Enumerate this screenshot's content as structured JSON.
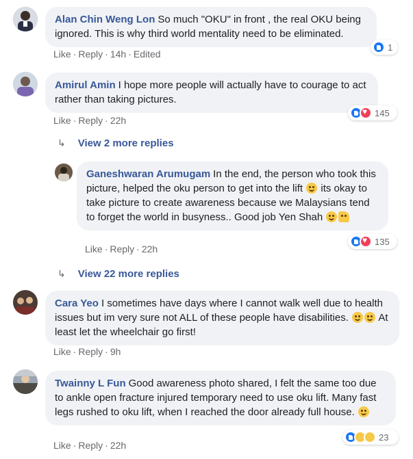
{
  "comments": [
    {
      "author": "Alan Chin Weng Lon",
      "text": "So much \"OKU\" in front , the real OKU being ignored. This is why third world mentality need to be eliminated.",
      "like": "Like",
      "reply": "Reply",
      "time": "14h",
      "edited": "Edited",
      "reaction_count": "1"
    },
    {
      "author": "Amirul Amin",
      "text": "I hope more people will actually have to courage to act rather than taking pictures.",
      "like": "Like",
      "reply": "Reply",
      "time": "22h",
      "reaction_count": "145",
      "more_replies": "View 2 more replies"
    },
    {
      "author": "Ganeshwaran Arumugam",
      "text_a": "In the end, the person who took this picture, helped the oku person to get into the lift",
      "text_b": "its okay to take picture to create awareness because we Malaysians tend to forget the world in busyness.. Good job Yen Shah",
      "like": "Like",
      "reply": "Reply",
      "time": "22h",
      "reaction_count": "135",
      "more_replies": "View 22 more replies"
    },
    {
      "author": "Cara Yeo",
      "text_a": "I sometimes have days where I cannot walk well due to health issues but im very sure not ALL of these people have disabilities.",
      "text_b": "At least let the wheelchair go first!",
      "like": "Like",
      "reply": "Reply",
      "time": "9h"
    },
    {
      "author": "Twainny L Fun",
      "text": "Good awareness photo shared, I felt the same too due to ankle open fracture injured temporary need to use oku lift. Many fast legs rushed to oku lift, when I reached the door already full house.",
      "like": "Like",
      "reply": "Reply",
      "time": "22h",
      "reaction_count": "23"
    }
  ],
  "colors": {
    "author": "#385898",
    "bubble": "#f0f2f5",
    "meta": "#65676b",
    "like_reaction": "#1877f2",
    "love_reaction": "#f33e58"
  },
  "icons": [
    "like-reaction-icon",
    "love-reaction-icon",
    "sad-reaction-icon",
    "wow-reaction-icon",
    "reply-arrow-icon",
    "smile-emoji-icon",
    "thumbs-up-emoji-icon",
    "thinking-emoji-icon",
    "sad-emoji-icon",
    "scream-emoji-icon"
  ]
}
